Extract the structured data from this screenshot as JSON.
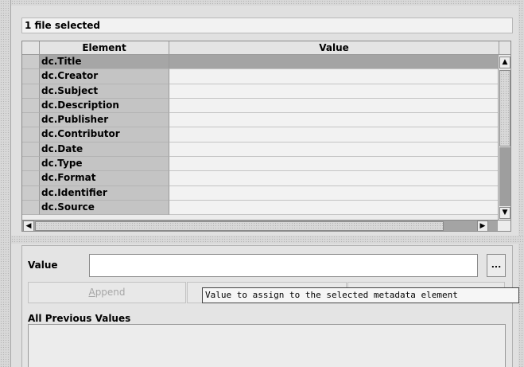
{
  "status": {
    "text": "1 file selected"
  },
  "table": {
    "headers": {
      "element": "Element",
      "value": "Value"
    },
    "rows": [
      {
        "element": "dc.Title",
        "value": "",
        "selected": true
      },
      {
        "element": "dc.Creator",
        "value": ""
      },
      {
        "element": "dc.Subject",
        "value": ""
      },
      {
        "element": "dc.Description",
        "value": ""
      },
      {
        "element": "dc.Publisher",
        "value": ""
      },
      {
        "element": "dc.Contributor",
        "value": ""
      },
      {
        "element": "dc.Date",
        "value": ""
      },
      {
        "element": "dc.Type",
        "value": ""
      },
      {
        "element": "dc.Format",
        "value": ""
      },
      {
        "element": "dc.Identifier",
        "value": ""
      },
      {
        "element": "dc.Source",
        "value": ""
      }
    ]
  },
  "editor": {
    "value_label": "Value",
    "value_input": "",
    "browse_label": "...",
    "append_label_mnemonic": "A",
    "append_label_rest": "ppend",
    "replace_label": "",
    "remove_label": "",
    "tooltip": "Value to assign to the selected metadata element",
    "previous_label": "All Previous Values",
    "previous_values": []
  },
  "icons": {
    "scroll_up": "arrow-up-icon",
    "scroll_down": "arrow-down-icon",
    "scroll_left": "arrow-left-icon",
    "scroll_right": "arrow-right-icon"
  }
}
